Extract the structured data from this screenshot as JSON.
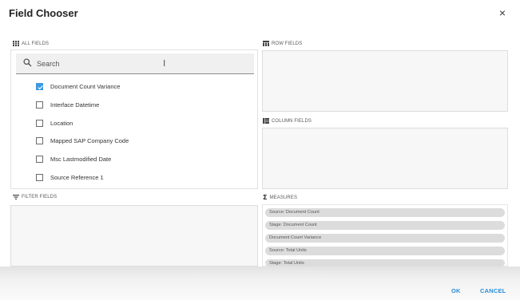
{
  "dialog": {
    "title": "Field Chooser",
    "close_glyph": "×"
  },
  "sections": {
    "all_fields": "ALL FIELDS",
    "row_fields": "ROW FIELDS",
    "column_fields": "COLUMN FIELDS",
    "filter_fields": "FILTER FIELDS",
    "measures": "MEASURES"
  },
  "search": {
    "placeholder": "Search",
    "value": ""
  },
  "fields": [
    {
      "label": "Document Count Variance",
      "checked": true
    },
    {
      "label": "Interface Datetime",
      "checked": false
    },
    {
      "label": "Location",
      "checked": false
    },
    {
      "label": "Mapped SAP Company Code",
      "checked": false
    },
    {
      "label": "Msc Lastmodified Date",
      "checked": false
    },
    {
      "label": "Source Reference 1",
      "checked": false
    }
  ],
  "measures": [
    "Source: Document Count",
    "Stage: Document Count",
    "Document Count Variance",
    "Source: Total Units",
    "Stage: Total Units"
  ],
  "footer": {
    "ok_label": "OK",
    "cancel_label": "CANCEL"
  },
  "colors": {
    "accent": "#2a8ed6",
    "checkbox": "#3b9ae3",
    "panel_bg": "#f7f7f7",
    "chip_bg": "#dcdcdc"
  },
  "icons": {
    "close": "close-icon",
    "search": "search-icon",
    "all_fields": "grid-icon",
    "row_fields": "row-layout-icon",
    "column_fields": "column-layout-icon",
    "filter_fields": "filter-icon",
    "measures": "sigma-icon"
  }
}
